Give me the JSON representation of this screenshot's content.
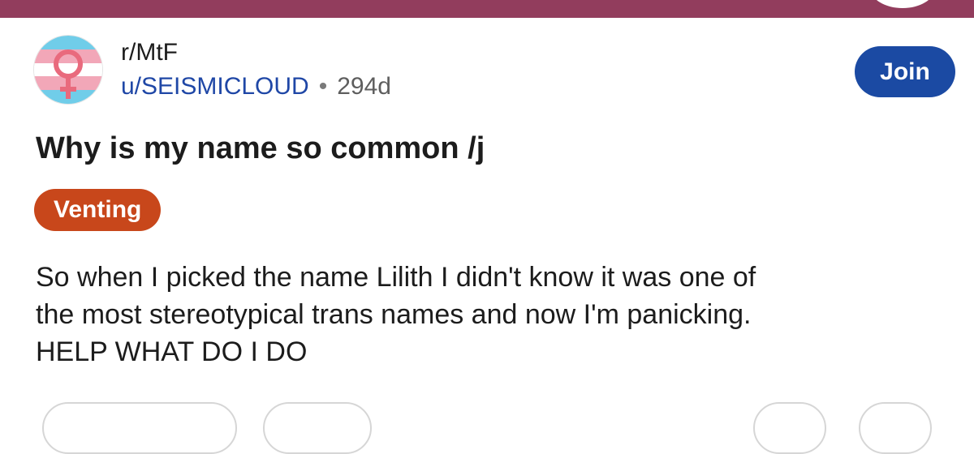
{
  "post": {
    "subreddit": "r/MtF",
    "username": "u/SEISMICLOUD",
    "separator": "•",
    "age": "294d",
    "join_label": "Join",
    "title": "Why is my name so common /j",
    "flair": "Venting",
    "body_lines": [
      "So when I picked the name Lilith I didn't know it was one of",
      "the most stereotypical trans names and now I'm panicking.",
      "HELP WHAT DO I DO"
    ]
  },
  "colors": {
    "header_bar": "#923d5d",
    "username": "#1f47a6",
    "join_button": "#1b4aa3",
    "flair_background": "#c8471b",
    "avatar_blue": "#70cde9",
    "avatar_pink": "#f2a7b8",
    "avatar_symbol": "#e96a7d"
  },
  "icons": {
    "avatar_symbol": "venus-symbol-icon"
  }
}
